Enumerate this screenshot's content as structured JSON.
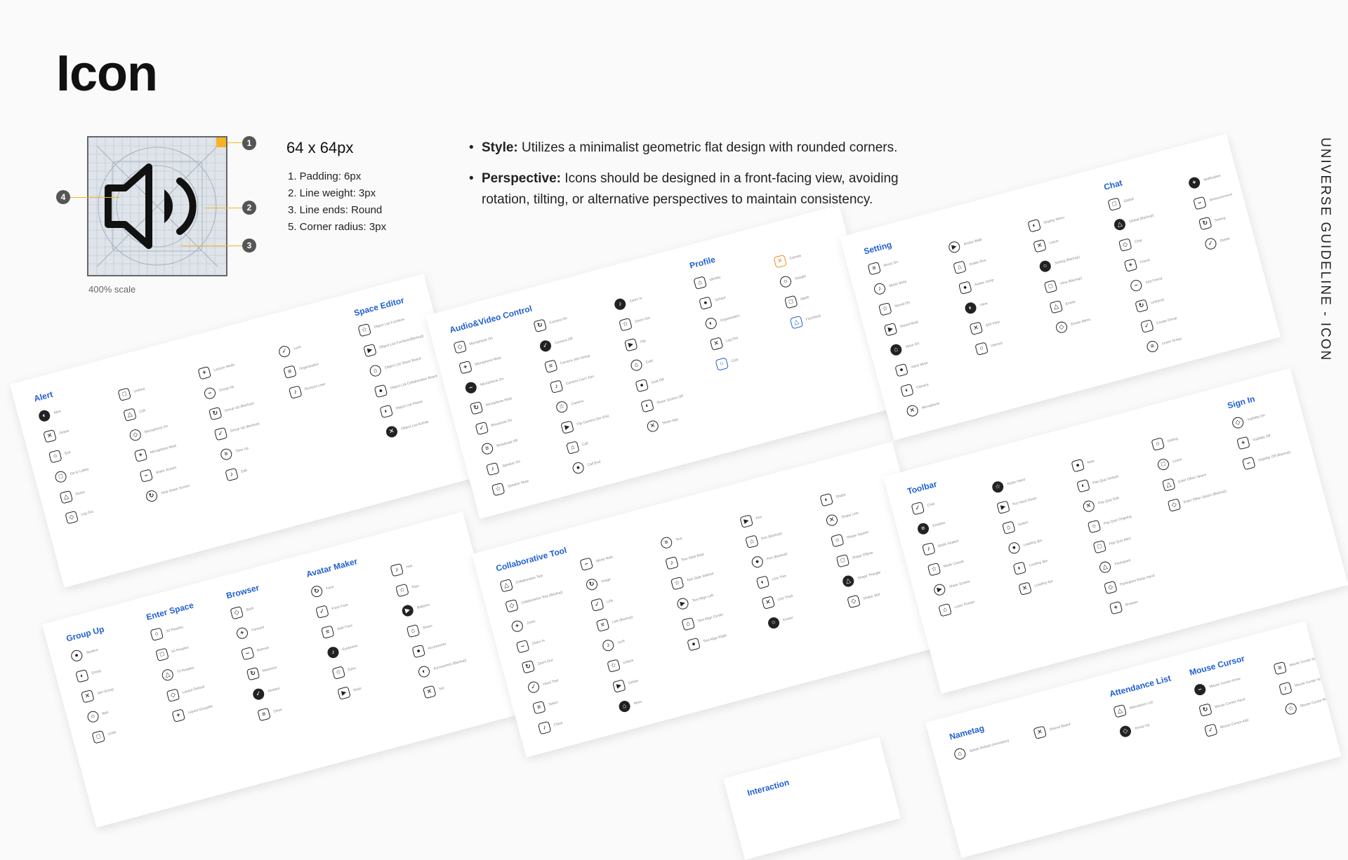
{
  "page": {
    "title": "Icon",
    "side_label": "UNIVERSE GUIDELINE - ICON"
  },
  "specimen": {
    "scale_note": "400% scale",
    "size_label": "64 x 64px",
    "callouts": [
      "1",
      "2",
      "3",
      "4"
    ],
    "specs": [
      "1.  Padding: 6px",
      "2.  Line weight: 3px",
      "3.  Line ends: Round",
      "5.  Corner radius: 3px"
    ],
    "icon": "speaker-icon",
    "accent": "#f5b324"
  },
  "principles": [
    {
      "term": "Style:",
      "text": " Utilizes a minimalist geometric flat design with rounded corners."
    },
    {
      "term": "Perspective:",
      "text": " Icons should be designed in a front-facing view, avoiding rotation, tilting, or alternative perspectives to maintain consistency."
    }
  ],
  "colors": {
    "category": "#1f5fd1",
    "icon": "#222222"
  },
  "sheets": [
    {
      "categories": [
        {
          "title": "Alert",
          "items": [
            "Alert",
            "Delete",
            "Exit",
            "Go to Lobby",
            "Reset",
            "Log Out"
          ]
        },
        {
          "title": "",
          "items": [
            "Unbind",
            "Call",
            "Microphone On",
            "Microphone Mute",
            "Share Screen",
            "Stop Share Screen"
          ]
        },
        {
          "title": "",
          "items": [
            "Lecture Mode",
            "Group Up",
            "Group Up (Backup)",
            "Group Up (Backup)",
            "Time Up",
            "Edit"
          ]
        },
        {
          "title": "",
          "items": [
            "Lock",
            "Organization",
            "Remove User"
          ]
        },
        {
          "title": "Space Editor",
          "items": [
            "Object List Furniture",
            "Object List Furniture(Backup)",
            "Object List Share Board",
            "Object List Collaborative Board",
            "Object List Planet",
            "Object List Activity"
          ]
        }
      ]
    },
    {
      "categories": [
        {
          "title": "Audio&Video Control",
          "items": [
            "Microphone On",
            "Microphone Mute",
            "Microphone On",
            "Microphone Mute",
            "Broadcast On",
            "Broadcast Off",
            "Speaker On",
            "Speaker Mute"
          ]
        },
        {
          "title": "",
          "items": [
            "Camera On",
            "Camera Off",
            "Camera Join Group",
            "Camera Can't Join",
            "Camera",
            "Flip Camera (for iOS)",
            "Call",
            "Call End"
          ]
        },
        {
          "title": "",
          "items": [
            "Zoom In",
            "Zoom Out",
            "Flip",
            "Cast",
            "Cast Off",
            "Share Screen Off",
            "Share App"
          ]
        },
        {
          "title": "Profile",
          "items": [
            "Identity",
            "School",
            "Organization",
            "Log Out",
            "Coin"
          ]
        },
        {
          "title": "",
          "items": [
            "Canvas",
            "Google",
            "Apple",
            "Facebook"
          ]
        }
      ]
    },
    {
      "categories": [
        {
          "title": "Setting",
          "items": [
            "Music On",
            "Music Mute",
            "Sound On",
            "Sound Mute",
            "Voice On",
            "Voice Mute",
            "Camera",
            "Microphone"
          ]
        },
        {
          "title": "",
          "items": [
            "Avatar Walk",
            "Avatar Run",
            "Avatar Jump",
            "View",
            "Self View",
            "Interact"
          ]
        },
        {
          "title": "",
          "items": [
            "Display Menu",
            "Leave",
            "Setting (Backup)",
            "View (Backup)",
            "Emote",
            "Emote Menu"
          ]
        },
        {
          "title": "Chat",
          "items": [
            "Global",
            "Global (Backup)",
            "Chat",
            "Friend",
            "Add Friend",
            "Unfriend",
            "Create Group",
            "Leave Group"
          ]
        },
        {
          "title": "",
          "items": [
            "Notification",
            "Announcement",
            "Setting",
            "Delete"
          ]
        }
      ]
    },
    {
      "categories": [
        {
          "title": "Group Up",
          "items": [
            "Student",
            "Group",
            "Join Group",
            "Bell",
            "Undo"
          ]
        },
        {
          "title": "Enter Space",
          "items": [
            "30 Peoples",
            "50 Peoples",
            "70 Peoples",
            "Layout Default",
            "Layout Grouplife"
          ]
        },
        {
          "title": "Browser",
          "items": [
            "Back",
            "Forward",
            "Refresh",
            "Maximize",
            "Restore",
            "Close"
          ]
        },
        {
          "title": "Avatar Maker",
          "items": [
            "Face",
            "Front Face",
            "Side Face",
            "Eyebrows",
            "Eyes",
            "Nose"
          ]
        },
        {
          "title": "",
          "items": [
            "Hair",
            "Tops",
            "Bottoms",
            "Shoes",
            "Accessories",
            "Accessories (Backup)",
            "Set"
          ]
        }
      ]
    },
    {
      "categories": [
        {
          "title": "Collaborative Tool",
          "items": [
            "Collaborative Tool",
            "Collaborative Tool (Backup)",
            "Zoom",
            "Zoom In",
            "Zoom Out",
            "Hand Tool",
            "Select",
            "Close"
          ]
        },
        {
          "title": "",
          "items": [
            "Sticky Note",
            "Image",
            "Link",
            "Link (Backup)",
            "Lock",
            "Unlock",
            "Delete",
            "More"
          ]
        },
        {
          "title": "",
          "items": [
            "Text",
            "Text Style Bold",
            "Text Style Italicize",
            "Text Align Left",
            "Text Align Center",
            "Text Align Right"
          ]
        },
        {
          "title": "",
          "items": [
            "Pen",
            "Pen (Backup)",
            "Pen (Backup)",
            "Line Thin",
            "Line Thick",
            "Eraser"
          ]
        },
        {
          "title": "",
          "items": [
            "Shape",
            "Shape Line",
            "Shape Square",
            "Shape Ellipse",
            "Shape Triangle",
            "Shape Star"
          ]
        }
      ]
    },
    {
      "categories": [
        {
          "title": "Toolbar",
          "items": [
            "Chat",
            "Emotion",
            "Mode Seated",
            "Mode Casual",
            "Share Screen",
            "Laser Pointer"
          ]
        },
        {
          "title": "",
          "items": [
            "Raise Hand",
            "Put Hand Down",
            "Switch",
            "Loading 2px",
            "Loading 3px",
            "Loading 4px"
          ]
        },
        {
          "title": "",
          "items": [
            "Note",
            "Pop Quiz Default",
            "Pop Quiz Edit",
            "Pop Quiz Ongoing",
            "Pop Quiz Alert",
            "Participant",
            "Participant Raise Hand",
            "Browser"
          ]
        },
        {
          "title": "",
          "items": [
            "Setting",
            "Leave",
            "Enter Other Space",
            "Enter Other Space (Backup)"
          ]
        },
        {
          "title": "Sign In",
          "items": [
            "Visibility On",
            "Visibility Off",
            "Visibility Off (Backup)"
          ]
        }
      ]
    },
    {
      "categories": [
        {
          "title": "Nametag",
          "items": [
            "Speak Default (Animation)"
          ]
        },
        {
          "title": "",
          "items": [
            "Shared Board"
          ]
        },
        {
          "title": "Attendance List",
          "items": [
            "Attendance List",
            "Group Up"
          ]
        },
        {
          "title": "Mouse Cursor",
          "items": [
            "Mouse Cursor Arrow",
            "Mouse Cursor Hand",
            "Mouse Cursor Add"
          ]
        },
        {
          "title": "",
          "items": [
            "Mouse Cursor Scale",
            "Mouse Cursor Scale",
            "Mouse Cursor Rotate"
          ]
        }
      ]
    },
    {
      "categories": [
        {
          "title": "Interaction",
          "items": []
        }
      ]
    }
  ]
}
